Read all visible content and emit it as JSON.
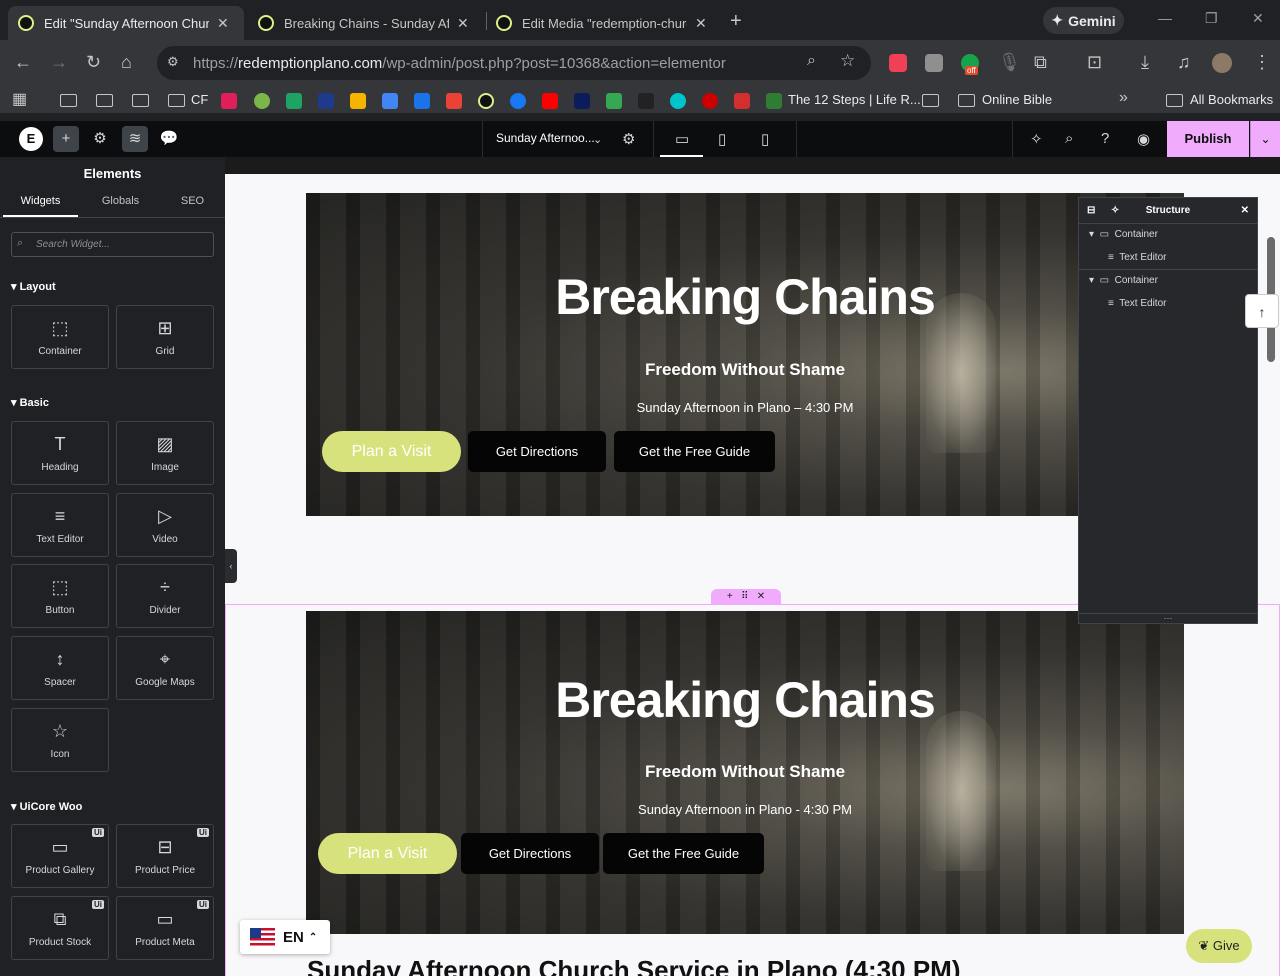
{
  "browser": {
    "tabs": [
      {
        "title": "Edit \"Sunday Afternoon Church",
        "active": true
      },
      {
        "title": "Breaking Chains - Sunday Aftern",
        "active": false
      },
      {
        "title": "Edit Media \"redemption-church",
        "active": false
      }
    ],
    "gemini_label": "Gemini",
    "url_prefix": "https://",
    "url_domain": "redemptionplano.com",
    "url_path": "/wp-admin/post.php?post=10368&action=elementor",
    "bookmarks": {
      "cf": "CF",
      "twelve_steps": "The 12 Steps | Life R...",
      "online_bible": "Online Bible",
      "all_bookmarks": "All Bookmarks"
    },
    "extension_badge": "off"
  },
  "elementor": {
    "page_name": "Sunday Afternoo...",
    "publish_label": "Publish",
    "panel": {
      "title": "Elements",
      "tabs": [
        "Widgets",
        "Globals",
        "SEO"
      ],
      "search_placeholder": "Search Widget...",
      "categories": {
        "layout": "Layout",
        "basic": "Basic",
        "uicore": "UiCore Woo"
      },
      "layout_widgets": [
        "Container",
        "Grid"
      ],
      "basic_widgets": [
        "Heading",
        "Image",
        "Text Editor",
        "Video",
        "Button",
        "Divider",
        "Spacer",
        "Google Maps",
        "Icon"
      ],
      "uicore_widgets": [
        "Product Gallery",
        "Product Price",
        "Product Stock",
        "Product Meta"
      ],
      "ui_badge": "Ui"
    },
    "structure": {
      "title": "Structure",
      "rows": [
        "Container",
        "Text Editor",
        "Container",
        "Text Editor"
      ]
    }
  },
  "hero": {
    "title": "Breaking Chains",
    "subtitle": "Freedom Without Shame",
    "time": "Sunday Afternoon in Plano – 4:30 PM",
    "time_alt": "Sunday Afternoon in Plano - 4:30 PM",
    "buttons": [
      "Plan a Visit",
      "Get Directions",
      "Get the Free Guide"
    ]
  },
  "section_heading": "Sunday Afternoon Church Service in Plano (4:30 PM)",
  "lang_label": "EN",
  "give_label": "Give"
}
